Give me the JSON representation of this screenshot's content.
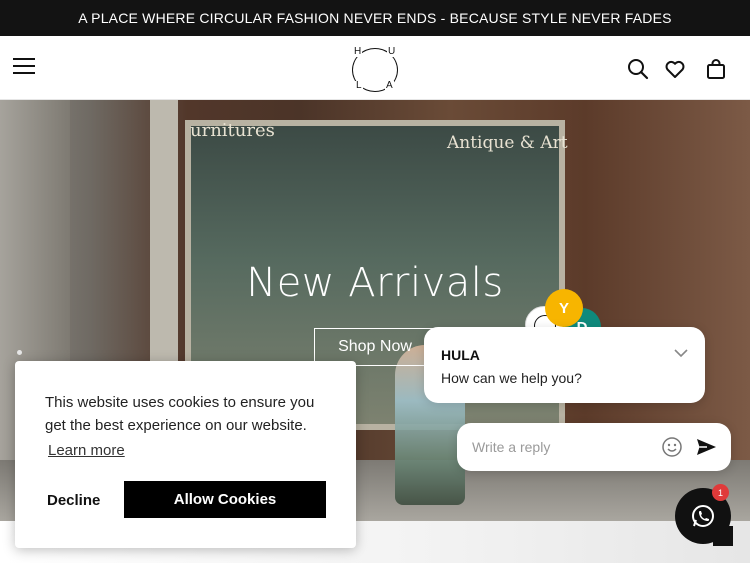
{
  "announcement": "A PLACE WHERE CIRCULAR FASHION NEVER ENDS - BECAUSE STYLE NEVER FADES",
  "logo": {
    "letters": {
      "h": "H",
      "u": "U",
      "l": "L",
      "a": "A"
    }
  },
  "header": {
    "icons": [
      "menu-icon",
      "search-icon",
      "heart-icon",
      "bag-icon"
    ]
  },
  "hero": {
    "signs": {
      "left": "urnitures",
      "right": "Antique & Art"
    },
    "title": "New Arrivals",
    "cta": "Shop Now"
  },
  "cookie": {
    "message": "This website uses cookies to ensure you get the best experience on our website.",
    "learn_more": "Learn more",
    "decline": "Decline",
    "allow": "Allow Cookies"
  },
  "chat": {
    "agents": [
      {
        "initial": "Y",
        "color": "#f7b500"
      },
      {
        "initial": "D",
        "color": "#0f8a7c"
      }
    ],
    "name": "HULA",
    "greeting": "How can we help you?",
    "reply_placeholder": "Write a reply",
    "unread": "1"
  },
  "colors": {
    "announce_bg": "#131313",
    "accent_black": "#000000"
  }
}
